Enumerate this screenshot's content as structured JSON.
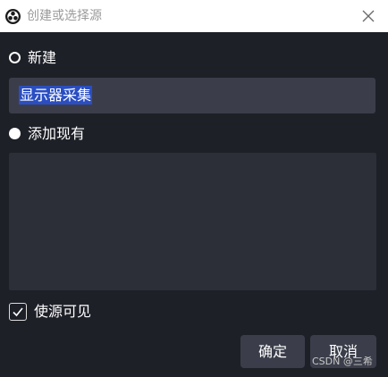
{
  "window": {
    "title": "创建或选择源",
    "logo_icon": "obs-logo-icon",
    "close_icon": "close-icon"
  },
  "options": {
    "create_new": {
      "label": "新建",
      "selected": true,
      "name_value": "显示器采集"
    },
    "add_existing": {
      "label": "添加现有",
      "selected": false,
      "items": []
    }
  },
  "visible_checkbox": {
    "label": "使源可见",
    "checked": true
  },
  "buttons": {
    "ok_label": "确定",
    "cancel_label": "取消"
  },
  "watermark": "CSDN @三希",
  "colors": {
    "background": "#1e2028",
    "input_bg": "#3b3e4a",
    "list_bg": "#2c2e38",
    "selection": "#2a4ec2",
    "titlebar": "#ffffff"
  }
}
